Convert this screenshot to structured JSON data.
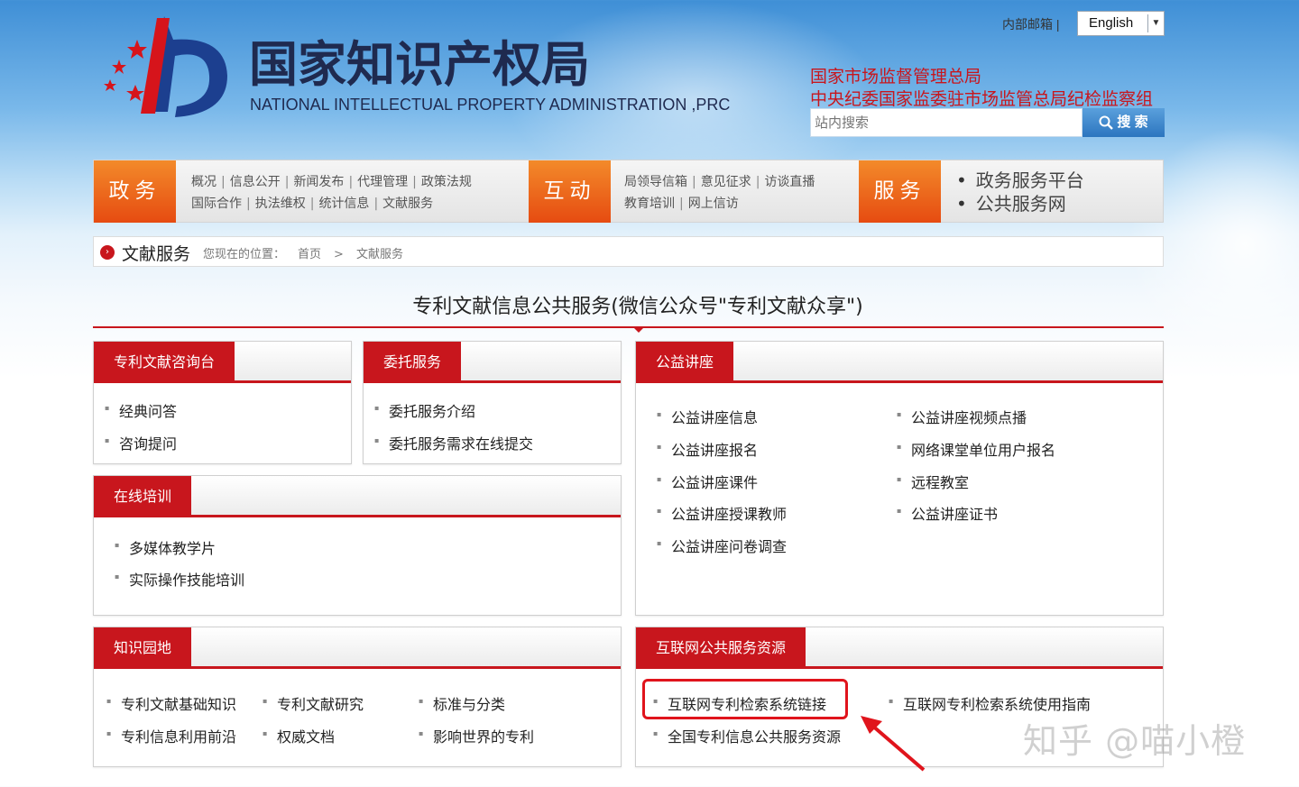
{
  "header": {
    "title_cn": "国家知识产权局",
    "title_en": "NATIONAL INTELLECTUAL PROPERTY ADMINISTRATION ,PRC",
    "mail_link": "内部邮箱 |",
    "language": "English",
    "org_link_1": "国家市场监督管理总局",
    "org_link_2": "中央纪委国家监委驻市场监管总局纪检监察组",
    "search_placeholder": "站内搜索",
    "search_button": "搜 索"
  },
  "nav": {
    "tab1": "政务",
    "tab1_row1": [
      "概况",
      "信息公开",
      "新闻发布",
      "代理管理",
      "政策法规"
    ],
    "tab1_row2": [
      "国际合作",
      "执法维权",
      "统计信息",
      "文献服务"
    ],
    "tab2": "互动",
    "tab2_row1": [
      "局领导信箱",
      "意见征求",
      "访谈直播"
    ],
    "tab2_row2": [
      "教育培训",
      "网上信访"
    ],
    "tab3": "服务",
    "tab3_items": [
      "政务服务平台",
      "公共服务网"
    ]
  },
  "breadcrumb": {
    "title": "文献服务",
    "location_label": "您现在的位置：",
    "home": "首页",
    "sep": ">",
    "current": "文献服务"
  },
  "section_title": "专利文献信息公共服务(微信公众号\"专利文献众享\")",
  "boxes": {
    "consult": {
      "title": "专利文献咨询台",
      "items": [
        "经典问答",
        "咨询提问"
      ]
    },
    "entrust": {
      "title": "委托服务",
      "items": [
        "委托服务介绍",
        "委托服务需求在线提交"
      ]
    },
    "lecture": {
      "title": "公益讲座",
      "col1": [
        "公益讲座信息",
        "公益讲座报名",
        "公益讲座课件",
        "公益讲座授课教师",
        "公益讲座问卷调查"
      ],
      "col2": [
        "公益讲座视频点播",
        "网络课堂单位用户报名",
        "远程教室",
        "公益讲座证书"
      ]
    },
    "training": {
      "title": "在线培训",
      "items": [
        "多媒体教学片",
        "实际操作技能培训"
      ]
    },
    "knowledge": {
      "title": "知识园地",
      "row1": [
        "专利文献基础知识",
        "专利文献研究",
        "标准与分类"
      ],
      "row2": [
        "专利信息利用前沿",
        "权威文档",
        "影响世界的专利"
      ]
    },
    "internet": {
      "title": "互联网公共服务资源",
      "items": [
        "互联网专利检索系统链接",
        "互联网专利检索系统使用指南",
        "全国专利信息公共服务资源"
      ]
    }
  },
  "watermark": "知乎 @喵小橙",
  "colors": {
    "brand_red": "#c8161d",
    "nav_orange": "#f07a23",
    "annotation_red": "#e0141c"
  }
}
